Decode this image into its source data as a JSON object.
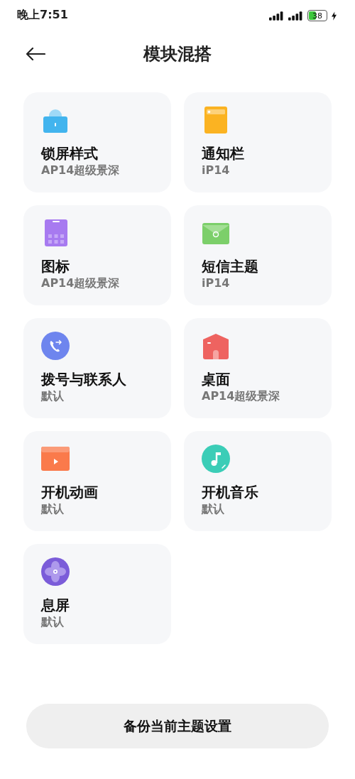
{
  "status_bar": {
    "time": "晚上7:51",
    "battery": "38"
  },
  "header": {
    "title": "模块混搭"
  },
  "modules": [
    {
      "kind": "lock",
      "title": "锁屏样式",
      "value": "AP14超级景深"
    },
    {
      "kind": "notification",
      "title": "通知栏",
      "value": "iP14"
    },
    {
      "kind": "icons",
      "title": "图标",
      "value": "AP14超级景深"
    },
    {
      "kind": "message",
      "title": "短信主题",
      "value": "iP14"
    },
    {
      "kind": "dialer",
      "title": "拨号与联系人",
      "value": "默认"
    },
    {
      "kind": "desktop",
      "title": "桌面",
      "value": "AP14超级景深"
    },
    {
      "kind": "animation",
      "title": "开机动画",
      "value": "默认"
    },
    {
      "kind": "music",
      "title": "开机音乐",
      "value": "默认"
    },
    {
      "kind": "aod",
      "title": "息屏",
      "value": "默认"
    }
  ],
  "backup_button": {
    "label": "备份当前主题设置"
  }
}
